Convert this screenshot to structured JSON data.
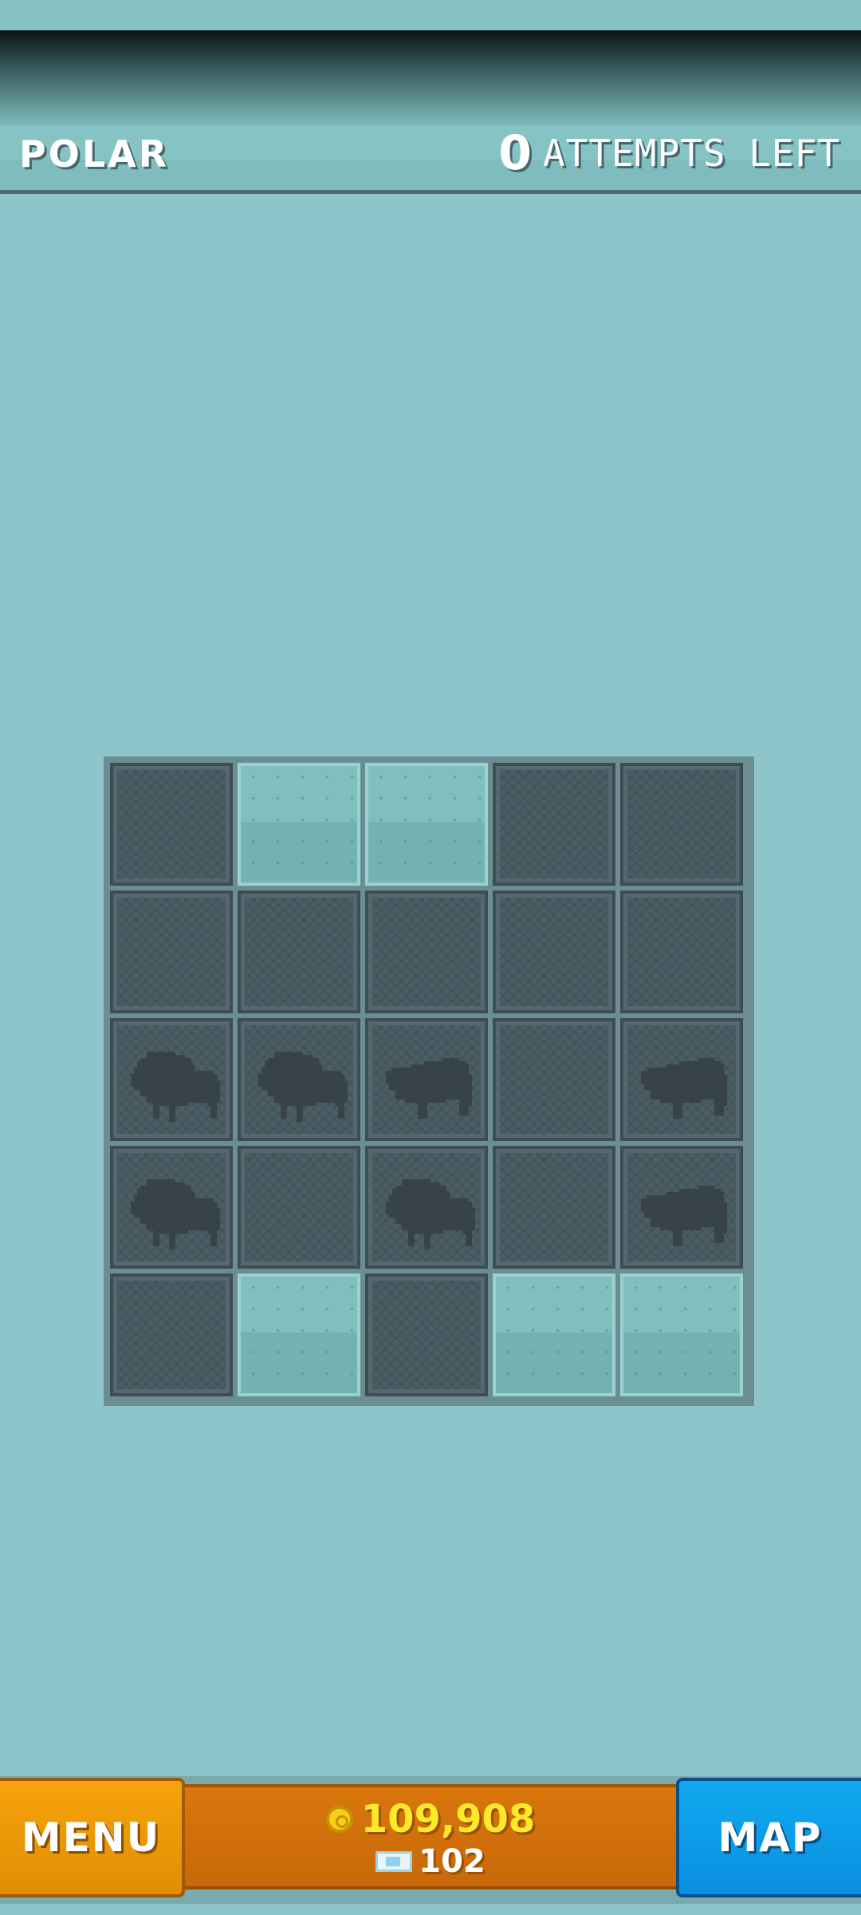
{
  "header": {
    "level_name": "POLAR",
    "attempts_count": "0",
    "attempts_label": "ATTEMPTS LEFT"
  },
  "board": {
    "rows": 5,
    "cols": 5,
    "tiles": [
      [
        "dark",
        "revealed",
        "revealed",
        "dark",
        "dark"
      ],
      [
        "dark",
        "dark",
        "dark",
        "dark",
        "dark"
      ],
      [
        "animal-left",
        "animal-left",
        "animal-right",
        "dark",
        "animal-right"
      ],
      [
        "animal-left",
        "dark",
        "animal-left",
        "dark",
        "animal-right"
      ],
      [
        "dark",
        "revealed",
        "dark",
        "revealed",
        "revealed"
      ]
    ],
    "animal_icon": "buffalo-silhouette-icon"
  },
  "footer": {
    "menu_label": "MENU",
    "coins": "109,908",
    "gems": "102",
    "map_label": "MAP"
  },
  "colors": {
    "background": "#8ec5ca",
    "tile_dark": "#4b5d64",
    "tile_revealed": "#78b8b8",
    "menu_button": "#f39c07",
    "currency_panel": "#d1700b",
    "map_button": "#0e9fe9",
    "coin_text": "#fde92a"
  }
}
